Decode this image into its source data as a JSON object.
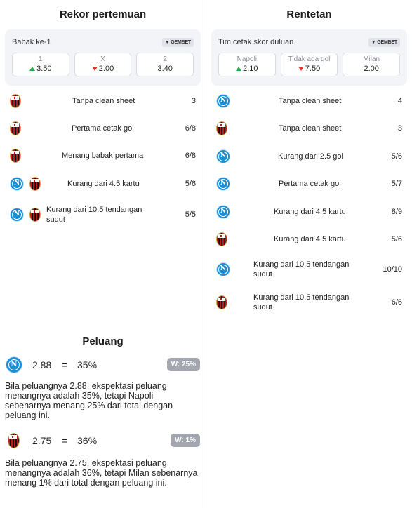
{
  "left": {
    "title": "Rekor pertemuan",
    "odds": {
      "label": "Babak ke-1",
      "brand": "GEMBET",
      "items": [
        {
          "name": "1",
          "value": "3.50",
          "trend": "up"
        },
        {
          "name": "X",
          "value": "2.00",
          "trend": "down"
        },
        {
          "name": "2",
          "value": "3.40",
          "trend": "none"
        }
      ]
    },
    "stats": [
      {
        "teams": [
          "milan"
        ],
        "label": "Tanpa clean sheet",
        "value": "3"
      },
      {
        "teams": [
          "milan"
        ],
        "label": "Pertama cetak gol",
        "value": "6/8"
      },
      {
        "teams": [
          "milan"
        ],
        "label": "Menang babak pertama",
        "value": "6/8"
      },
      {
        "teams": [
          "napoli",
          "milan"
        ],
        "label": "Kurang dari 4.5 kartu",
        "value": "5/6"
      },
      {
        "teams": [
          "napoli",
          "milan"
        ],
        "label": "Kurang dari 10.5 tendangan sudut",
        "value": "5/5"
      }
    ]
  },
  "right": {
    "title": "Rentetan",
    "odds": {
      "label": "Tim cetak skor duluan",
      "brand": "GEMBET",
      "items": [
        {
          "name": "Napoli",
          "value": "2.10",
          "trend": "up"
        },
        {
          "name": "Tidak ada gol",
          "value": "7.50",
          "trend": "down"
        },
        {
          "name": "Milan",
          "value": "2.00",
          "trend": "none"
        }
      ]
    },
    "stats": [
      {
        "teams": [
          "napoli"
        ],
        "label": "Tanpa clean sheet",
        "value": "4"
      },
      {
        "teams": [
          "milan"
        ],
        "label": "Tanpa clean sheet",
        "value": "3"
      },
      {
        "teams": [
          "napoli"
        ],
        "label": "Kurang dari 2.5 gol",
        "value": "5/6"
      },
      {
        "teams": [
          "napoli"
        ],
        "label": "Pertama cetak gol",
        "value": "5/7"
      },
      {
        "teams": [
          "napoli"
        ],
        "label": "Kurang dari 4.5 kartu",
        "value": "8/9"
      },
      {
        "teams": [
          "milan"
        ],
        "label": "Kurang dari 4.5 kartu",
        "value": "5/6"
      },
      {
        "teams": [
          "napoli"
        ],
        "label": "Kurang dari 10.5 tendangan sudut",
        "value": "10/10"
      },
      {
        "teams": [
          "milan"
        ],
        "label": "Kurang dari 10.5 tendangan sudut",
        "value": "6/6"
      }
    ]
  },
  "peluang": {
    "title": "Peluang",
    "eq": "=",
    "rows": [
      {
        "team": "napoli",
        "odd": "2.88",
        "pct": "35%",
        "badge": "W: 25%",
        "text": "Bila peluangnya 2.88, ekspektasi peluang menangnya adalah 35%, tetapi Napoli sebenarnya menang 25% dari total dengan peluang ini."
      },
      {
        "team": "milan",
        "odd": "2.75",
        "pct": "36%",
        "badge": "W: 1%",
        "text": "Bila peluangnya 2.75, ekspektasi peluang menangnya adalah 36%, tetapi Milan sebenarnya menang 1% dari total dengan peluang ini."
      }
    ]
  },
  "colors": {
    "up": "#2aa84a",
    "down": "#e0312a",
    "napoli": "#1a8fd6",
    "milan": "#c4161c"
  }
}
